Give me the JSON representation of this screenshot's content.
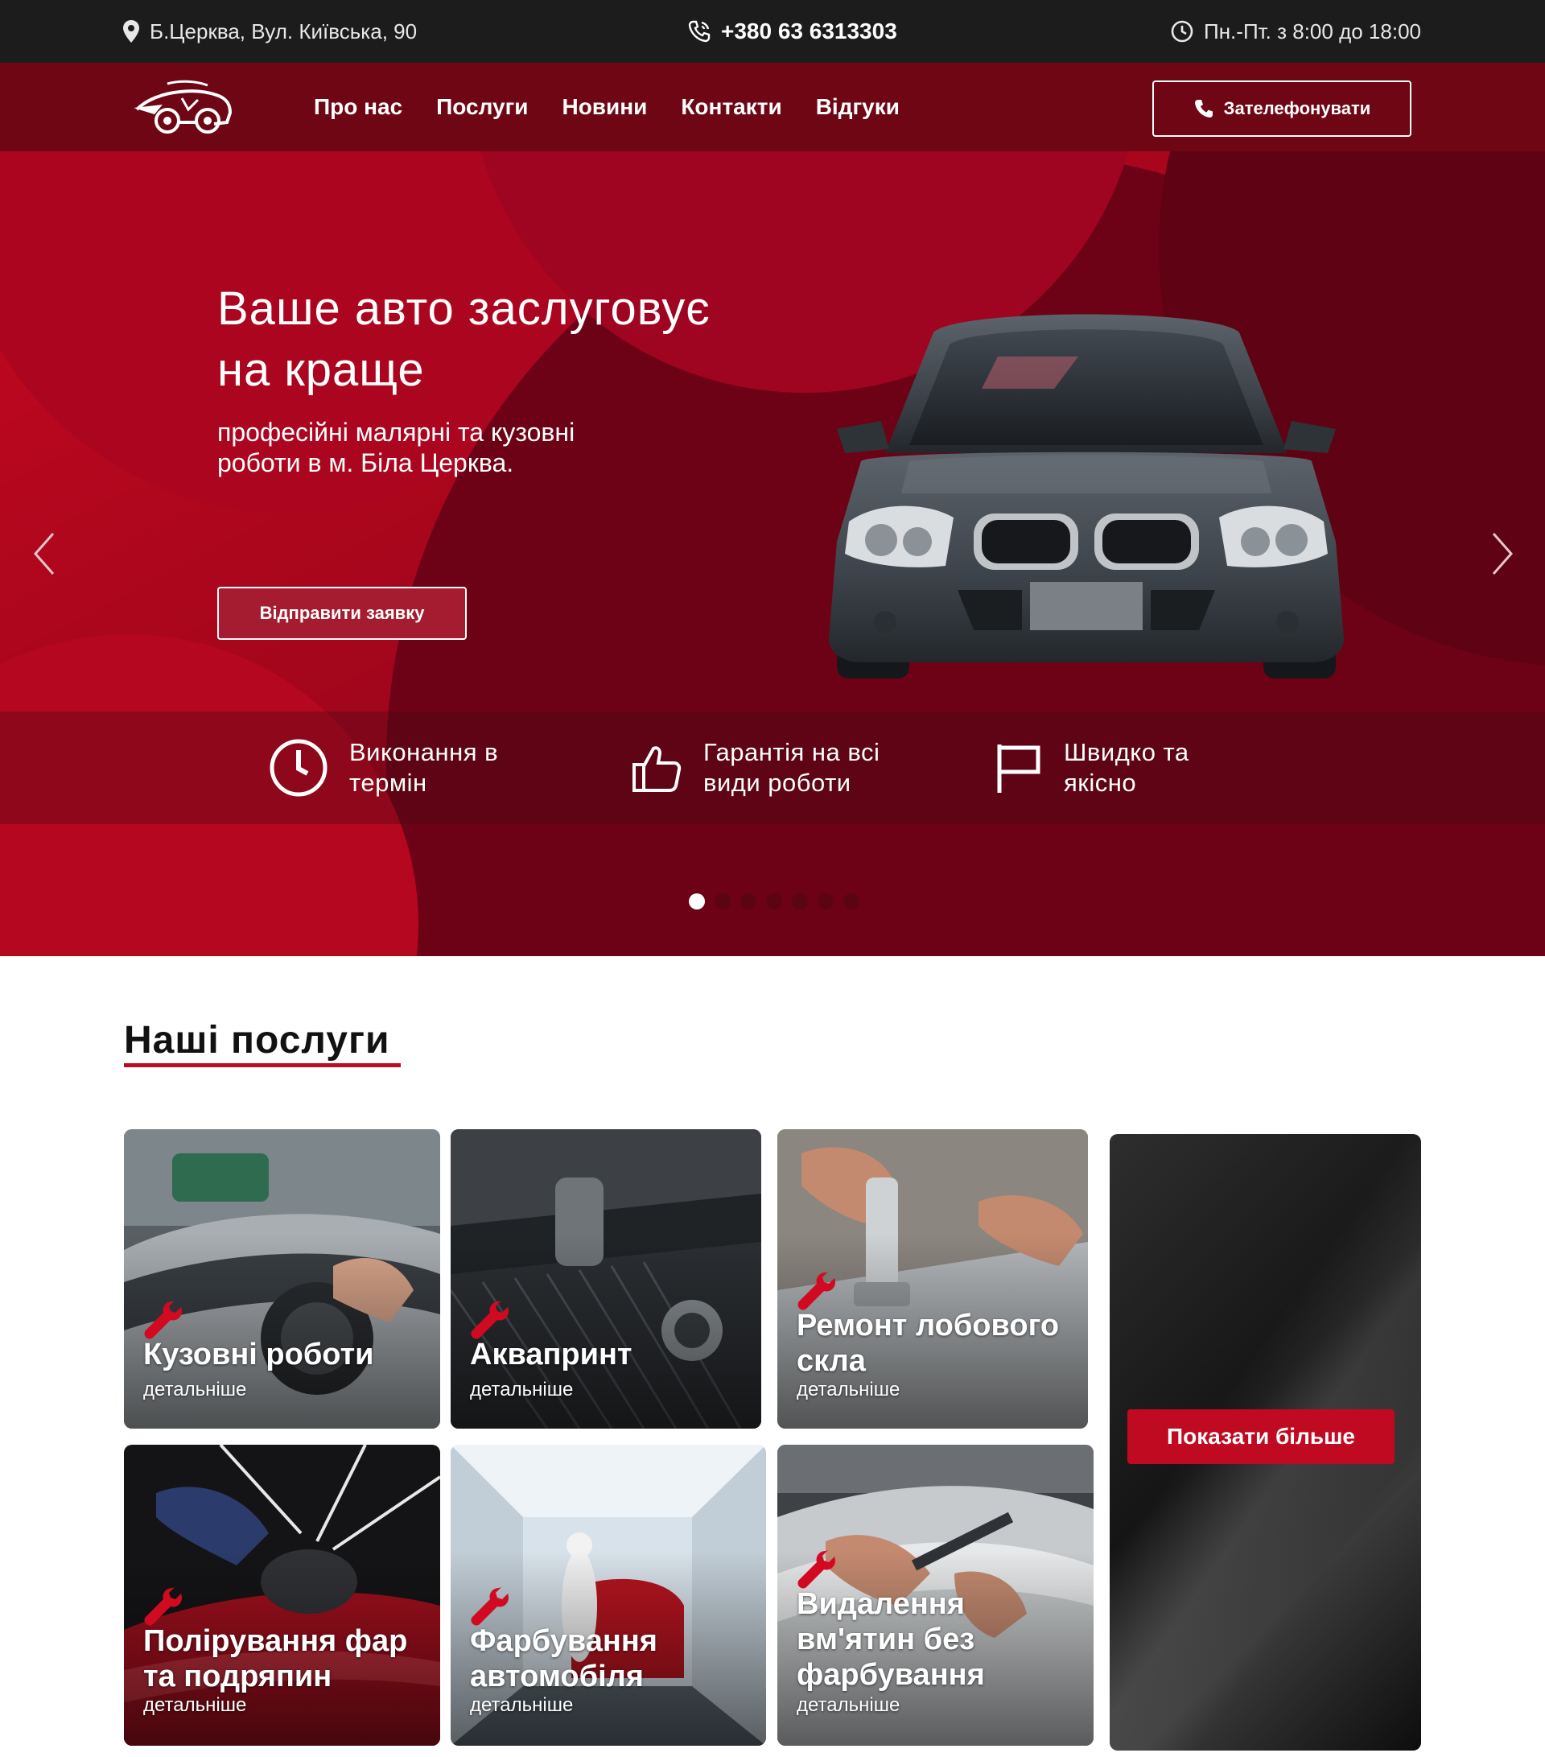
{
  "topbar": {
    "address": "Б.Церква, Вул. Київська, 90",
    "phone": "+380 63 6313303",
    "hours": "Пн.-Пт. з 8:00 до 18:00"
  },
  "nav": {
    "items": [
      "Про нас",
      "Послуги",
      "Новини",
      "Контакти",
      "Відгуки"
    ],
    "call_button": "Зателефонувати"
  },
  "hero": {
    "title_line1": "Ваше авто заслуговує",
    "title_line2": "на краще",
    "subtitle_line1": "професійні малярні та кузовні",
    "subtitle_line2": "роботи в м. Біла Церква.",
    "cta": "Відправити заявку",
    "features": [
      {
        "line1": "Виконання в",
        "line2": "термін",
        "icon": "clock-icon"
      },
      {
        "line1": "Гарантія на всі",
        "line2": "види роботи",
        "icon": "thumbs-up-icon"
      },
      {
        "line1": "Швидко та",
        "line2": "якісно",
        "icon": "flag-icon"
      }
    ],
    "slide_count": 7,
    "active_slide": 1
  },
  "services": {
    "title": "Наші послуги",
    "details_label": "детальніше",
    "items": [
      {
        "line1": "Кузовні роботи",
        "line2": ""
      },
      {
        "line1": "Аквапринт",
        "line2": ""
      },
      {
        "line1": "Ремонт лобового",
        "line2": "скла"
      },
      {
        "line1": "Полірування фар",
        "line2": "та подряпин"
      },
      {
        "line1": "Фарбування",
        "line2": "автомобіля"
      },
      {
        "line1": "Видалення",
        "line2": "вм'ятин без",
        "line3": "фарбування"
      }
    ],
    "show_more": "Показати більше"
  },
  "colors": {
    "brand_red": "#c00a22",
    "nav_dark_red": "#6e0614",
    "topbar": "#1c1c1c"
  }
}
